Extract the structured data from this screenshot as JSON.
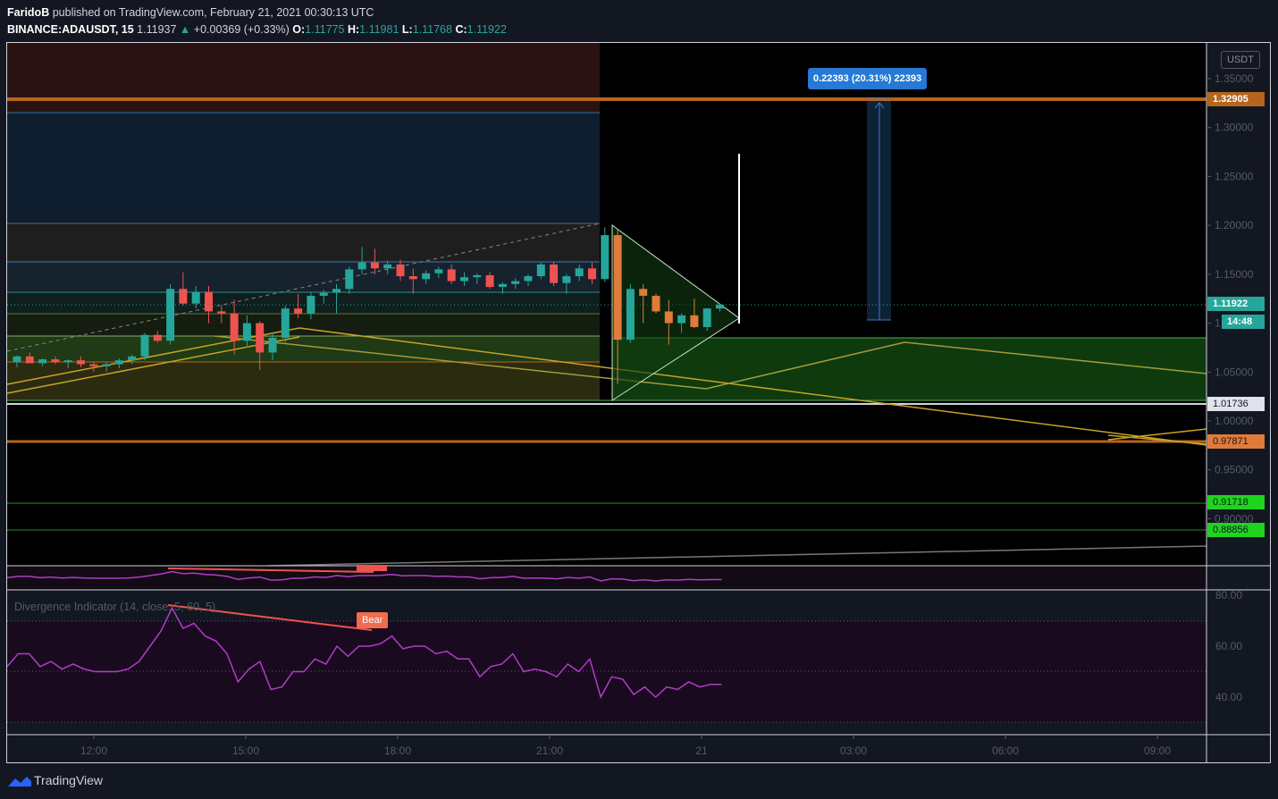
{
  "header": {
    "author": "FaridoB",
    "published_text": "published on TradingView.com, February 21, 2021 00:30:13 UTC",
    "symbol": "BINANCE:ADAUSDT, 15",
    "last": "1.11937",
    "change": "+0.00369 (+0.33%)",
    "o_label": "O:",
    "o": "1.11775",
    "h_label": "H:",
    "h": "1.11981",
    "l_label": "L:",
    "l": "1.11768",
    "c_label": "C:",
    "c": "1.11922"
  },
  "currency_button": "USDT",
  "price_badges": {
    "target": "1.32905",
    "last": "1.11922",
    "countdown": "14:48",
    "support": "1.01736",
    "level_orange": "0.97871",
    "level_green1": "0.91718",
    "level_green2": "0.88856"
  },
  "measure_label": "0.22393 (20.31%) 22393",
  "oscillator": {
    "label": "Divergence Indicator (14, close, 5, 60, 5)",
    "signal_label": "Bear",
    "ticks": [
      "80.00",
      "60.00",
      "40.00"
    ]
  },
  "footer": {
    "brand": "TradingView"
  },
  "colors": {
    "bull": "#26a69a",
    "bear": "#ef5350",
    "orange_candle": "#e07b39",
    "rsi": "#b03cc8",
    "target_line": "#b5651d",
    "green_zone": "#2e7d32"
  },
  "chart_data": {
    "type": "candlestick",
    "symbol": "BINANCE:ADAUSDT",
    "interval": "15",
    "time_axis": [
      "12:00",
      "15:00",
      "18:00",
      "21:00",
      "21",
      "03:00",
      "06:00",
      "09:00"
    ],
    "price_axis": [
      "1.35000",
      "1.30000",
      "1.25000",
      "1.20000",
      "1.15000",
      "1.10000",
      "1.05000",
      "1.00000",
      "0.95000",
      "0.90000"
    ],
    "ylim": [
      0.86,
      1.37
    ],
    "horizontal_levels": [
      1.32905,
      1.01736,
      0.97871,
      0.91718,
      0.88856
    ],
    "candles": [
      [
        1.06,
        1.067,
        1.055,
        1.066
      ],
      [
        1.066,
        1.07,
        1.06,
        1.059
      ],
      [
        1.059,
        1.064,
        1.056,
        1.063
      ],
      [
        1.063,
        1.066,
        1.058,
        1.06
      ],
      [
        1.06,
        1.063,
        1.054,
        1.062
      ],
      [
        1.062,
        1.066,
        1.055,
        1.058
      ],
      [
        1.058,
        1.061,
        1.05,
        1.056
      ],
      [
        1.056,
        1.06,
        1.05,
        1.058
      ],
      [
        1.058,
        1.064,
        1.054,
        1.062
      ],
      [
        1.062,
        1.068,
        1.058,
        1.066
      ],
      [
        1.066,
        1.09,
        1.062,
        1.088
      ],
      [
        1.088,
        1.092,
        1.08,
        1.082
      ],
      [
        1.082,
        1.14,
        1.078,
        1.135
      ],
      [
        1.135,
        1.152,
        1.118,
        1.12
      ],
      [
        1.12,
        1.138,
        1.115,
        1.132
      ],
      [
        1.132,
        1.138,
        1.1,
        1.112
      ],
      [
        1.112,
        1.118,
        1.1,
        1.11
      ],
      [
        1.11,
        1.124,
        1.068,
        1.082
      ],
      [
        1.082,
        1.108,
        1.075,
        1.1
      ],
      [
        1.1,
        1.102,
        1.052,
        1.07
      ],
      [
        1.07,
        1.09,
        1.062,
        1.085
      ],
      [
        1.085,
        1.118,
        1.08,
        1.115
      ],
      [
        1.115,
        1.13,
        1.105,
        1.11
      ],
      [
        1.11,
        1.132,
        1.104,
        1.128
      ],
      [
        1.128,
        1.134,
        1.12,
        1.131
      ],
      [
        1.131,
        1.14,
        1.11,
        1.135
      ],
      [
        1.135,
        1.158,
        1.13,
        1.155
      ],
      [
        1.155,
        1.178,
        1.15,
        1.162
      ],
      [
        1.162,
        1.176,
        1.15,
        1.156
      ],
      [
        1.156,
        1.164,
        1.15,
        1.16
      ],
      [
        1.16,
        1.165,
        1.143,
        1.148
      ],
      [
        1.148,
        1.156,
        1.13,
        1.145
      ],
      [
        1.145,
        1.154,
        1.14,
        1.151
      ],
      [
        1.151,
        1.158,
        1.146,
        1.155
      ],
      [
        1.155,
        1.16,
        1.14,
        1.143
      ],
      [
        1.143,
        1.152,
        1.138,
        1.147
      ],
      [
        1.147,
        1.151,
        1.14,
        1.149
      ],
      [
        1.149,
        1.152,
        1.135,
        1.137
      ],
      [
        1.137,
        1.142,
        1.13,
        1.14
      ],
      [
        1.14,
        1.146,
        1.135,
        1.143
      ],
      [
        1.143,
        1.15,
        1.138,
        1.148
      ],
      [
        1.148,
        1.162,
        1.145,
        1.16
      ],
      [
        1.16,
        1.163,
        1.138,
        1.141
      ],
      [
        1.141,
        1.15,
        1.13,
        1.148
      ],
      [
        1.148,
        1.16,
        1.143,
        1.156
      ],
      [
        1.156,
        1.162,
        1.14,
        1.145
      ],
      [
        1.145,
        1.198,
        1.142,
        1.19
      ],
      [
        1.19,
        1.196,
        1.038,
        1.083
      ],
      [
        1.083,
        1.14,
        1.08,
        1.135
      ],
      [
        1.135,
        1.14,
        1.1,
        1.128
      ],
      [
        1.128,
        1.13,
        1.11,
        1.112
      ],
      [
        1.112,
        1.124,
        1.078,
        1.1
      ],
      [
        1.1,
        1.11,
        1.09,
        1.108
      ],
      [
        1.108,
        1.125,
        1.095,
        1.096
      ],
      [
        1.096,
        1.115,
        1.092,
        1.115
      ],
      [
        1.115,
        1.12,
        1.112,
        1.119
      ]
    ],
    "oscillator_values": [
      52,
      57,
      57,
      52,
      54,
      51,
      53,
      51,
      50,
      50,
      50,
      51,
      54,
      60,
      66,
      75,
      67,
      69,
      64,
      62,
      57,
      46,
      51,
      54,
      43,
      44,
      50,
      50,
      55,
      53,
      60,
      56,
      60,
      60,
      61,
      64,
      59,
      60,
      60,
      57,
      58,
      55,
      55,
      48,
      52,
      53,
      57,
      50,
      51,
      50,
      48,
      53,
      50,
      55,
      40,
      48,
      47,
      41,
      44,
      40,
      44,
      43,
      46,
      44,
      45,
      45
    ]
  }
}
